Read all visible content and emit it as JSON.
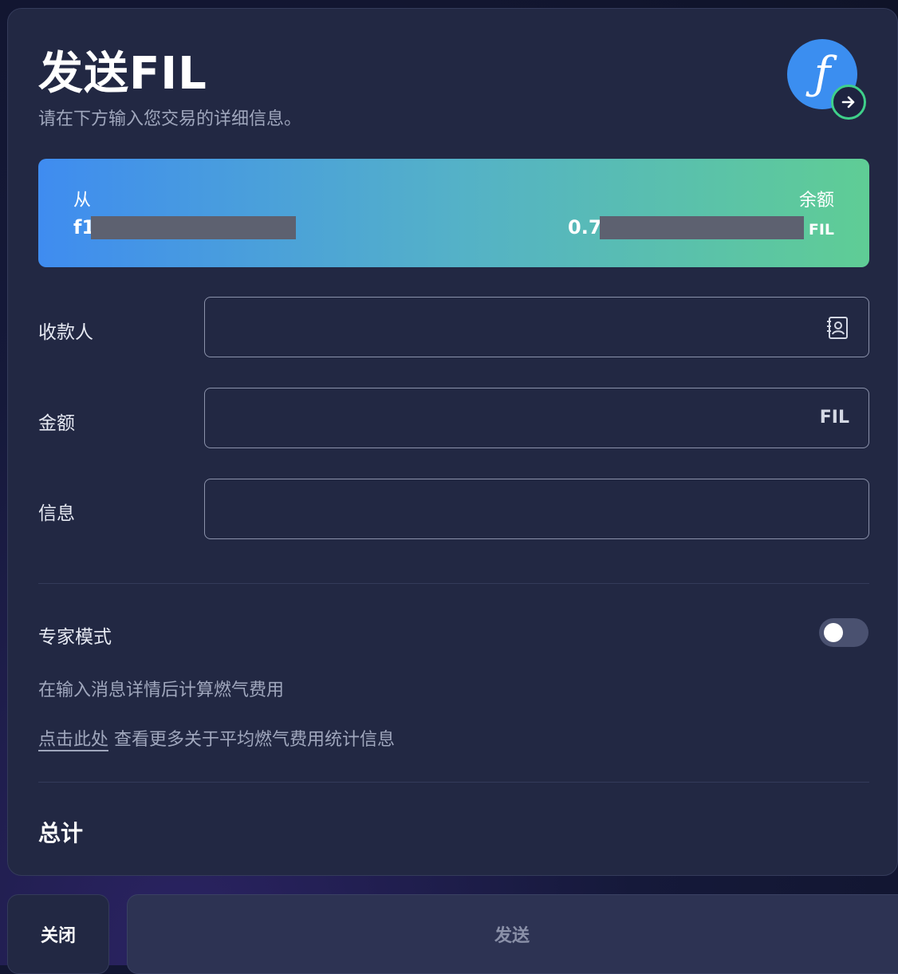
{
  "header": {
    "title": "发送FIL",
    "subtitle": "请在下方输入您交易的详细信息。",
    "logo_glyph": "ƒ",
    "logo_icon": "filecoin-logo-icon",
    "badge_icon": "arrow-right-icon"
  },
  "balance_card": {
    "from_label": "从",
    "from_address": "f1",
    "balance_label": "余额",
    "balance_value": "0.7",
    "balance_unit": "FIL"
  },
  "form": {
    "recipient": {
      "label": "收款人",
      "value": "",
      "icon": "address-book-icon"
    },
    "amount": {
      "label": "金额",
      "value": "",
      "unit": "FIL"
    },
    "message": {
      "label": "信息",
      "value": ""
    }
  },
  "expert": {
    "label": "专家模式",
    "enabled": false
  },
  "gas": {
    "note": "在输入消息详情后计算燃气费用",
    "link_text": "点击此处",
    "link_suffix": " 查看更多关于平均燃气费用统计信息"
  },
  "total": {
    "label": "总计"
  },
  "actions": {
    "close_label": "关闭",
    "send_label": "发送"
  },
  "colors": {
    "panel_bg": "#222843",
    "gradient_start": "#3f8cf0",
    "gradient_end": "#5fcd95",
    "accent_green": "#3fd08a"
  }
}
